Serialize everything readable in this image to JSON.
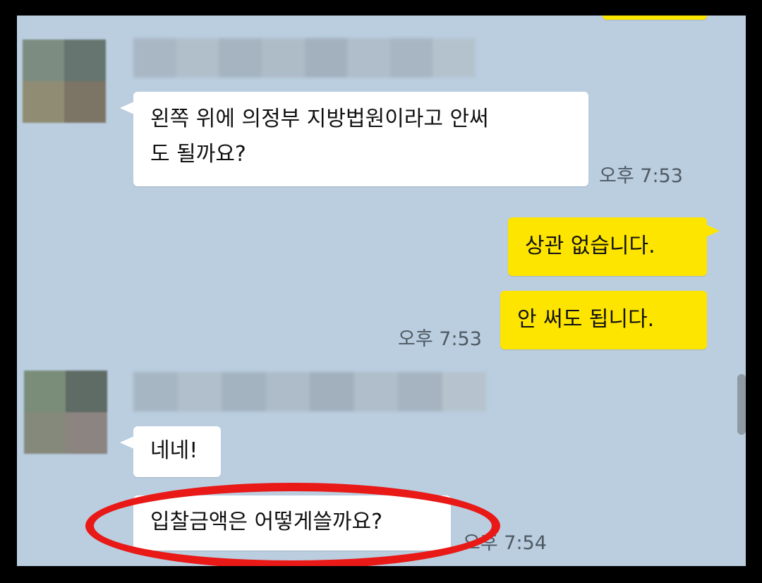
{
  "messages": {
    "in1": {
      "text_line1": "왼쪽 위에 의정부 지방법원이라고 안써",
      "text_line2": "도 될까요?",
      "time": "오후 7:53"
    },
    "out1": {
      "text": "상관 없습니다."
    },
    "out2": {
      "text": "안 써도 됩니다.",
      "time": "오후 7:53"
    },
    "in2": {
      "text": "네네!"
    },
    "in3": {
      "text": "입찰금액은 어떻게쓸까요?",
      "time": "오후 7:54"
    }
  },
  "colors": {
    "chat_background": "#bacee0",
    "incoming_bubble": "#ffffff",
    "outgoing_bubble": "#fee500",
    "highlight": "#e81916"
  }
}
